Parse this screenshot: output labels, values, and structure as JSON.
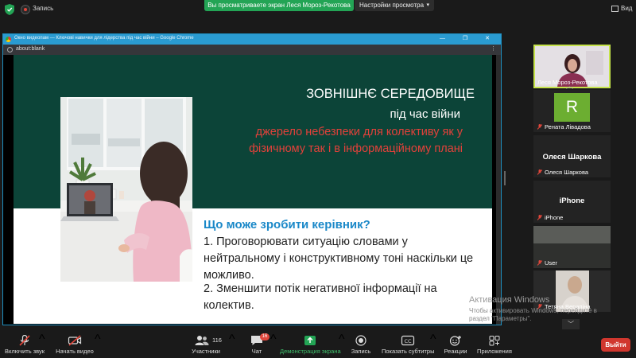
{
  "topbar": {
    "recording_label": "Запись",
    "sharing_banner": "Вы просматриваете экран Леся Мороз-Рекотова",
    "view_settings": "Настройки просмотра",
    "view_label": "Вид"
  },
  "browser": {
    "title": "Окно видеопам — Ключові навички для лідерства під час війни – Google Chrome",
    "address": "about:blank",
    "controls": "— ❐ ✕"
  },
  "slide": {
    "title": "ЗОВНІШНЄ СЕРЕДОВИЩЕ",
    "subtitle": "під час війни",
    "red_line1": "джерело небезпеки для колективу як у",
    "red_line2": "фізичному так і в інформаційному плані",
    "question": "Що може зробити керівник?",
    "point1": "1. Проговорювати ситуацію словами у нейтральному і конструктивному тоні наскільки це можливо.",
    "point2": "2. Зменшити потік негативної інформації на колектив."
  },
  "gallery": {
    "participants": [
      {
        "name": "Леся Мороз-Рекотова",
        "muted": false,
        "kind": "video"
      },
      {
        "name": "Рената Лівадова",
        "muted": true,
        "kind": "avatar",
        "avatar_letter": "R",
        "avatar_color": "#6cae31"
      },
      {
        "name": "Олеся Шаркова",
        "muted": true,
        "kind": "name",
        "big_name": "Олеся Шаркова"
      },
      {
        "name": "iPhone",
        "muted": true,
        "kind": "name",
        "big_name": "iPhone"
      },
      {
        "name": "User",
        "muted": true,
        "kind": "video"
      },
      {
        "name": "Тетяна Верапіна",
        "muted": true,
        "kind": "video"
      }
    ]
  },
  "watermark": {
    "title": "Активация Windows",
    "text": "Чтобы активировать Windows, перейдите в раздел \"Параметры\"."
  },
  "toolbar": {
    "unmute": "Включить звук",
    "start_video": "Начать видео",
    "participants": "Участники",
    "participants_count": "116",
    "chat": "Чат",
    "chat_badge": "16",
    "share": "Демонстрация экрана",
    "record": "Запись",
    "subtitles": "Показать субтитры",
    "reactions": "Реакции",
    "apps": "Приложения",
    "leave": "Выйти"
  },
  "colors": {
    "slide_green": "#0c4438",
    "slide_red": "#e3413a",
    "slide_blue": "#1a88c8",
    "share_green": "#23a455",
    "leave_red": "#d1372e",
    "active_speaker_border": "#c5e34b"
  }
}
